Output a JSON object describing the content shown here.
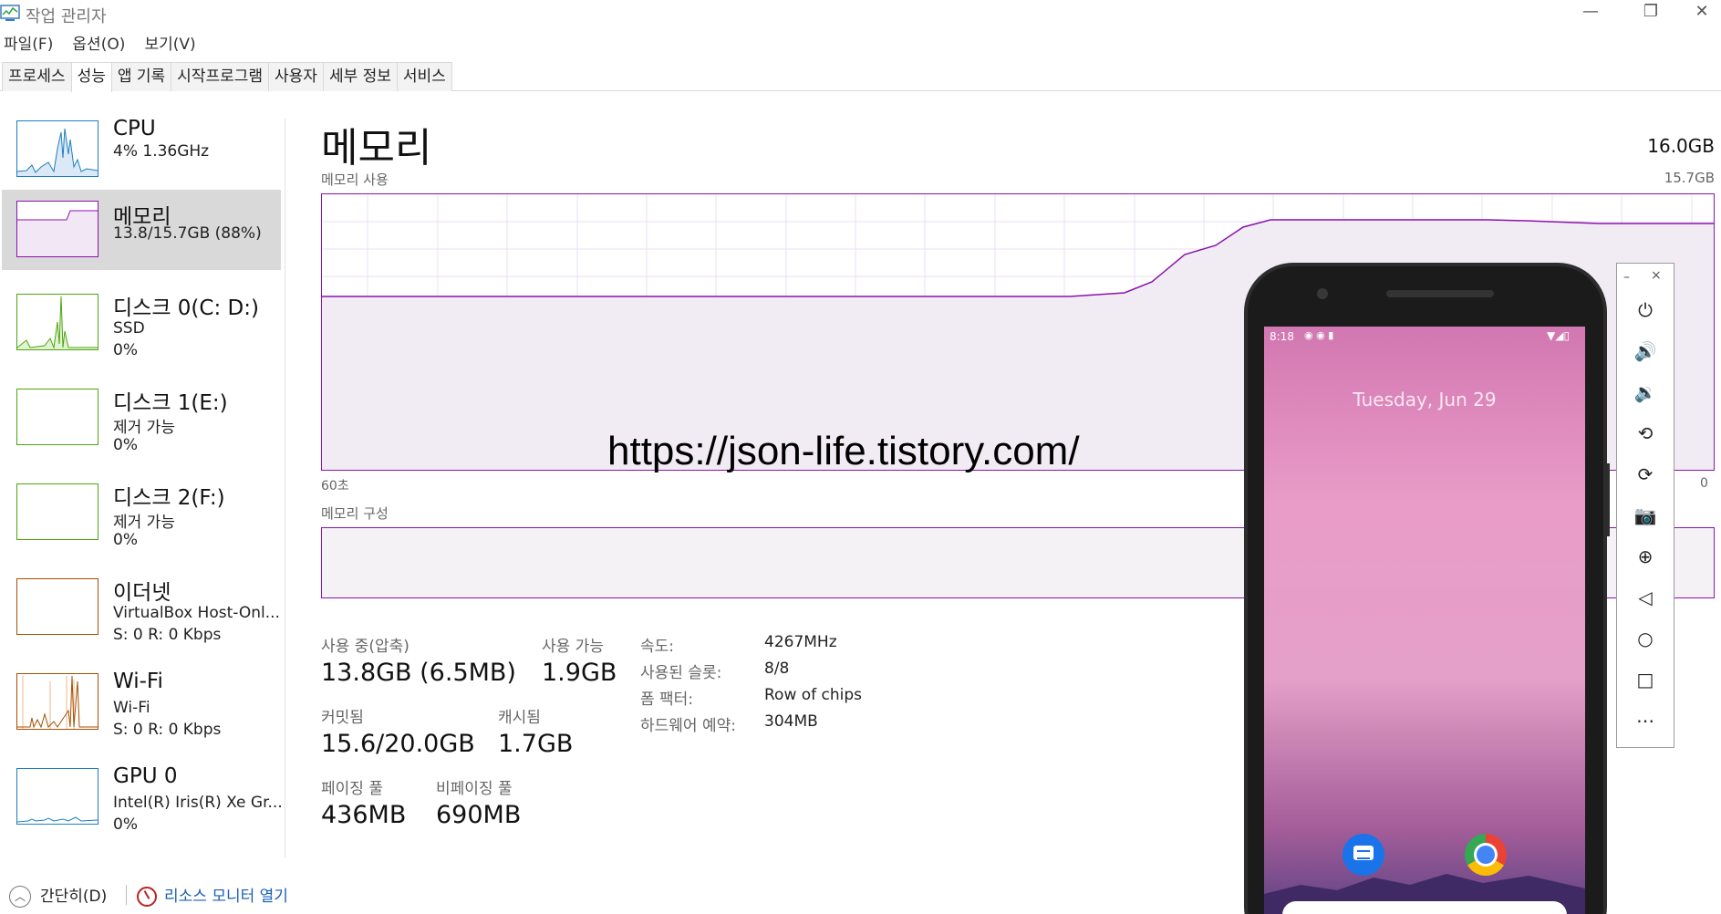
{
  "window": {
    "title": "작업 관리자",
    "buttons": {
      "minimize": "—",
      "restore": "❐",
      "close": "✕"
    }
  },
  "menu": [
    "파일(F)",
    "옵션(O)",
    "보기(V)"
  ],
  "tabs": [
    {
      "label": "프로세스",
      "active": false
    },
    {
      "label": "성능",
      "active": true
    },
    {
      "label": "앱 기록",
      "active": false
    },
    {
      "label": "시작프로그램",
      "active": false
    },
    {
      "label": "사용자",
      "active": false
    },
    {
      "label": "세부 정보",
      "active": false
    },
    {
      "label": "서비스",
      "active": false
    }
  ],
  "resources": [
    {
      "name": "CPU",
      "line1": "4% 1.36GHz",
      "line2": "",
      "color": "#1e7fc1",
      "selected": false
    },
    {
      "name": "메모리",
      "line1": "13.8/15.7GB (88%)",
      "line2": "",
      "color": "#8b12ae",
      "selected": true
    },
    {
      "name": "디스크 0(C: D:)",
      "line1": "SSD",
      "line2": "0%",
      "color": "#4da60c",
      "selected": false
    },
    {
      "name": "디스크 1(E:)",
      "line1": "제거 가능",
      "line2": "0%",
      "color": "#4da60c",
      "selected": false
    },
    {
      "name": "디스크 2(F:)",
      "line1": "제거 가능",
      "line2": "0%",
      "color": "#4da60c",
      "selected": false
    },
    {
      "name": "이더넷",
      "line1": "VirtualBox Host-Onl...",
      "line2": "S: 0 R: 0 Kbps",
      "color": "#a74f01",
      "selected": false
    },
    {
      "name": "Wi-Fi",
      "line1": "Wi-Fi",
      "line2": "S: 0 R: 0 Kbps",
      "color": "#a74f01",
      "selected": false
    },
    {
      "name": "GPU 0",
      "line1": "Intel(R) Iris(R) Xe Gr...",
      "line2": "0%",
      "color": "#1e7fc1",
      "selected": false
    }
  ],
  "main": {
    "title": "메모리",
    "total": "16.0GB",
    "usage_label": "메모리 사용",
    "usage_max": "15.7GB",
    "time_left": "60초",
    "time_right": "0",
    "composition_label": "메모리 구성",
    "graph_color": "#8b12ae",
    "stats": {
      "in_use_label": "사용 중(압축)",
      "in_use_value": "13.8GB (6.5MB)",
      "available_label": "사용 가능",
      "available_value": "1.9GB",
      "committed_label": "커밋됨",
      "committed_value": "15.6/20.0GB",
      "cached_label": "캐시됨",
      "cached_value": "1.7GB",
      "paged_label": "페이징 풀",
      "paged_value": "436MB",
      "nonpaged_label": "비페이징 풀",
      "nonpaged_value": "690MB"
    },
    "specs": [
      {
        "label": "속도:",
        "value": "4267MHz"
      },
      {
        "label": "사용된 슬롯:",
        "value": "8/8"
      },
      {
        "label": "폼 팩터:",
        "value": "Row of chips"
      },
      {
        "label": "하드웨어 예약:",
        "value": "304MB"
      }
    ]
  },
  "watermark": "https://json-life.tistory.com/",
  "footer": {
    "fewer_details": "간단히(D)",
    "resource_monitor": "리소스 모니터 열기"
  },
  "phone": {
    "time": "8:18",
    "date": "Tuesday, Jun 29"
  },
  "emulator_toolbar": {
    "minimize": "–",
    "close": "×",
    "buttons": [
      {
        "name": "power-icon",
        "glyph": "⏻"
      },
      {
        "name": "volume-up-icon",
        "glyph": "🔊"
      },
      {
        "name": "volume-down-icon",
        "glyph": "🔉"
      },
      {
        "name": "rotate-left-icon",
        "glyph": "⟲"
      },
      {
        "name": "rotate-right-icon",
        "glyph": "⟳"
      },
      {
        "name": "camera-icon",
        "glyph": "📷"
      },
      {
        "name": "zoom-icon",
        "glyph": "⊕"
      },
      {
        "name": "back-icon",
        "glyph": "◁"
      },
      {
        "name": "home-icon",
        "glyph": "○"
      },
      {
        "name": "overview-icon",
        "glyph": "□"
      },
      {
        "name": "more-icon",
        "glyph": "⋯"
      }
    ]
  }
}
